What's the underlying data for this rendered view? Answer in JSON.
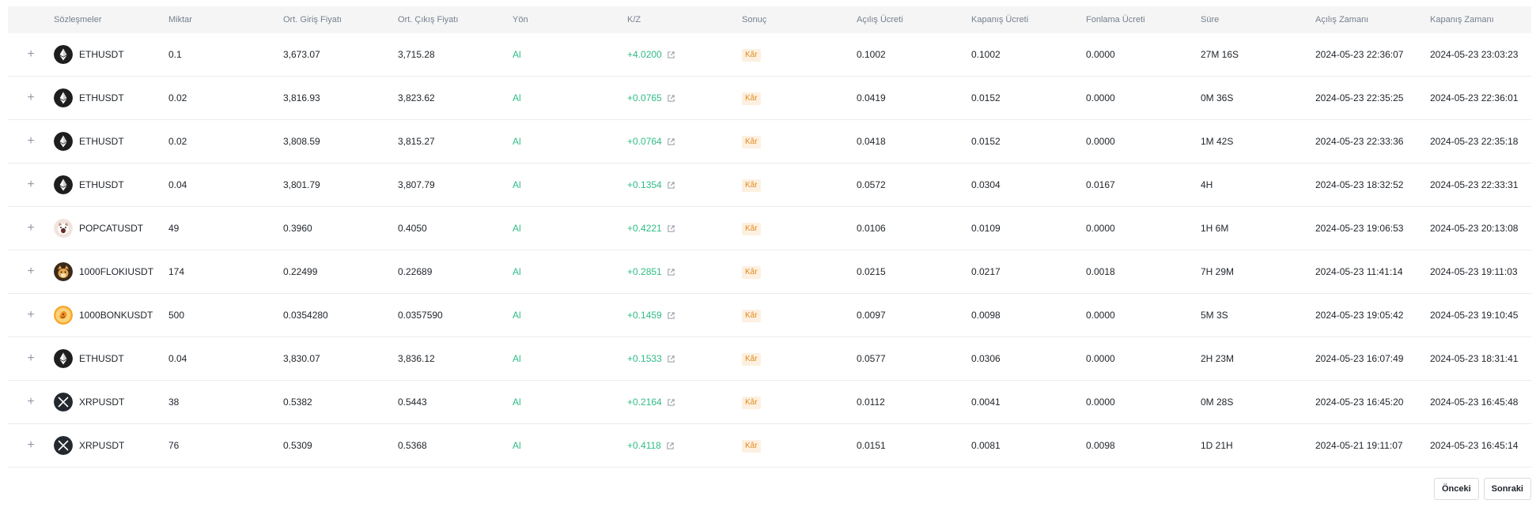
{
  "columns": [
    "Sözleşmeler",
    "Miktar",
    "Ort. Giriş Fiyatı",
    "Ort. Çıkış Fiyatı",
    "Yön",
    "K/Z",
    "Sonuç",
    "Açılış Ücreti",
    "Kapanış Ücreti",
    "Fonlama Ücreti",
    "Süre",
    "Açılış Zamanı",
    "Kapanış Zamanı"
  ],
  "rows": [
    {
      "icon": "eth",
      "symbol": "ETHUSDT",
      "qty": "0.1",
      "entry": "3,673.07",
      "exit": "3,715.28",
      "side": "Al",
      "pnl": "+4.0200",
      "result": "Kâr",
      "open_fee": "0.1002",
      "close_fee": "0.1002",
      "funding_fee": "0.0000",
      "duration": "27M 16S",
      "open_time": "2024-05-23 22:36:07",
      "close_time": "2024-05-23 23:03:23"
    },
    {
      "icon": "eth",
      "symbol": "ETHUSDT",
      "qty": "0.02",
      "entry": "3,816.93",
      "exit": "3,823.62",
      "side": "Al",
      "pnl": "+0.0765",
      "result": "Kâr",
      "open_fee": "0.0419",
      "close_fee": "0.0152",
      "funding_fee": "0.0000",
      "duration": "0M 36S",
      "open_time": "2024-05-23 22:35:25",
      "close_time": "2024-05-23 22:36:01"
    },
    {
      "icon": "eth",
      "symbol": "ETHUSDT",
      "qty": "0.02",
      "entry": "3,808.59",
      "exit": "3,815.27",
      "side": "Al",
      "pnl": "+0.0764",
      "result": "Kâr",
      "open_fee": "0.0418",
      "close_fee": "0.0152",
      "funding_fee": "0.0000",
      "duration": "1M 42S",
      "open_time": "2024-05-23 22:33:36",
      "close_time": "2024-05-23 22:35:18"
    },
    {
      "icon": "eth",
      "symbol": "ETHUSDT",
      "qty": "0.04",
      "entry": "3,801.79",
      "exit": "3,807.79",
      "side": "Al",
      "pnl": "+0.1354",
      "result": "Kâr",
      "open_fee": "0.0572",
      "close_fee": "0.0304",
      "funding_fee": "0.0167",
      "duration": "4H",
      "open_time": "2024-05-23 18:32:52",
      "close_time": "2024-05-23 22:33:31"
    },
    {
      "icon": "popcat",
      "symbol": "POPCATUSDT",
      "qty": "49",
      "entry": "0.3960",
      "exit": "0.4050",
      "side": "Al",
      "pnl": "+0.4221",
      "result": "Kâr",
      "open_fee": "0.0106",
      "close_fee": "0.0109",
      "funding_fee": "0.0000",
      "duration": "1H 6M",
      "open_time": "2024-05-23 19:06:53",
      "close_time": "2024-05-23 20:13:08"
    },
    {
      "icon": "floki",
      "symbol": "1000FLOKIUSDT",
      "qty": "174",
      "entry": "0.22499",
      "exit": "0.22689",
      "side": "Al",
      "pnl": "+0.2851",
      "result": "Kâr",
      "open_fee": "0.0215",
      "close_fee": "0.0217",
      "funding_fee": "0.0018",
      "duration": "7H 29M",
      "open_time": "2024-05-23 11:41:14",
      "close_time": "2024-05-23 19:11:03"
    },
    {
      "icon": "bonk",
      "symbol": "1000BONKUSDT",
      "qty": "500",
      "entry": "0.0354280",
      "exit": "0.0357590",
      "side": "Al",
      "pnl": "+0.1459",
      "result": "Kâr",
      "open_fee": "0.0097",
      "close_fee": "0.0098",
      "funding_fee": "0.0000",
      "duration": "5M 3S",
      "open_time": "2024-05-23 19:05:42",
      "close_time": "2024-05-23 19:10:45"
    },
    {
      "icon": "eth",
      "symbol": "ETHUSDT",
      "qty": "0.04",
      "entry": "3,830.07",
      "exit": "3,836.12",
      "side": "Al",
      "pnl": "+0.1533",
      "result": "Kâr",
      "open_fee": "0.0577",
      "close_fee": "0.0306",
      "funding_fee": "0.0000",
      "duration": "2H 23M",
      "open_time": "2024-05-23 16:07:49",
      "close_time": "2024-05-23 18:31:41"
    },
    {
      "icon": "xrp",
      "symbol": "XRPUSDT",
      "qty": "38",
      "entry": "0.5382",
      "exit": "0.5443",
      "side": "Al",
      "pnl": "+0.2164",
      "result": "Kâr",
      "open_fee": "0.0112",
      "close_fee": "0.0041",
      "funding_fee": "0.0000",
      "duration": "0M 28S",
      "open_time": "2024-05-23 16:45:20",
      "close_time": "2024-05-23 16:45:48"
    },
    {
      "icon": "xrp",
      "symbol": "XRPUSDT",
      "qty": "76",
      "entry": "0.5309",
      "exit": "0.5368",
      "side": "Al",
      "pnl": "+0.4118",
      "result": "Kâr",
      "open_fee": "0.0151",
      "close_fee": "0.0081",
      "funding_fee": "0.0098",
      "duration": "1D 21H",
      "open_time": "2024-05-21 19:11:07",
      "close_time": "2024-05-23 16:45:14"
    }
  ],
  "expand_glyph": "+",
  "pagination": {
    "prev": "Önceki",
    "next": "Sonraki"
  },
  "colors": {
    "buy": "#2ebd85",
    "profit": "#2ebd85",
    "badge_bg": "#fdf0e0",
    "badge_text": "#e08a1e",
    "header_bg": "#f5f5f5"
  }
}
